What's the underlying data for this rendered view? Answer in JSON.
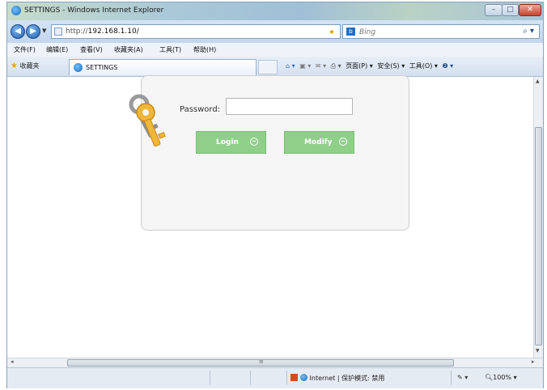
{
  "window": {
    "title": "SETTINGS - Windows Internet Explorer",
    "controls": {
      "minimize": "–",
      "maximize": "□",
      "close": "✕"
    }
  },
  "addressbar": {
    "url_prefix": "http://",
    "url_host": "192.168.1.10/",
    "search_placeholder": "Bing",
    "icons": [
      "compat-icon",
      "refresh-icon",
      "stop-icon"
    ]
  },
  "menubar": {
    "items": [
      "文件(F)",
      "编辑(E)",
      "查看(V)",
      "收藏夹(A)",
      "工具(T)",
      "帮助(H)"
    ]
  },
  "tabbar": {
    "favorites_label": "收藏夹",
    "tab_title": "SETTINGS",
    "commands": [
      "页面(P) ▾",
      "安全(S) ▾",
      "工具(O) ▾",
      "❷ ▾"
    ]
  },
  "statusbar": {
    "zone_text": "Internet | 保护模式: 禁用",
    "zoom": "100%"
  },
  "login": {
    "password_label": "Password:",
    "password_value": "",
    "login_button": "Login",
    "modify_button": "Modify"
  },
  "colors": {
    "button_green": "#8fcf8a",
    "panel_bg": "#f5f5f5"
  }
}
